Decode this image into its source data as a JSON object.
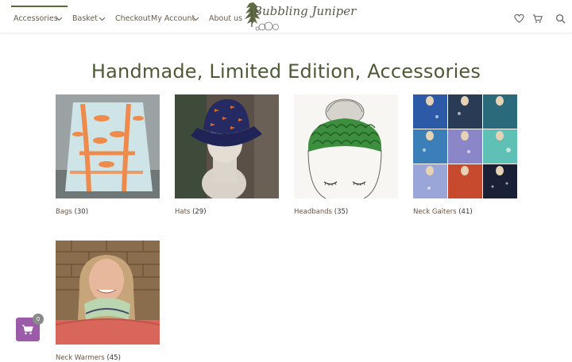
{
  "nav": {
    "items": [
      {
        "label": "Accessories",
        "has_dropdown": true,
        "active": true
      },
      {
        "label": "Basket",
        "has_dropdown": true
      },
      {
        "label": "Checkout",
        "has_dropdown": false
      },
      {
        "label": "My Account",
        "has_dropdown": true
      },
      {
        "label": "About us",
        "has_dropdown": false
      }
    ],
    "accent_color": "#5b6b3d"
  },
  "logo": {
    "text": "Bubbling Juniper"
  },
  "header_icons": [
    "heart-icon",
    "cart-icon",
    "search-icon"
  ],
  "page": {
    "title": "Handmade, Limited Edition, Accessories"
  },
  "categories": [
    {
      "name": "Bags",
      "count": "(30)"
    },
    {
      "name": "Hats",
      "count": "(29)"
    },
    {
      "name": "Headbands",
      "count": "(35)"
    },
    {
      "name": "Neck Gaiters",
      "count": "(41)"
    },
    {
      "name": "Neck Warmers",
      "count": "(45)"
    }
  ],
  "cart": {
    "count": "0",
    "color": "#9b5ba8"
  }
}
